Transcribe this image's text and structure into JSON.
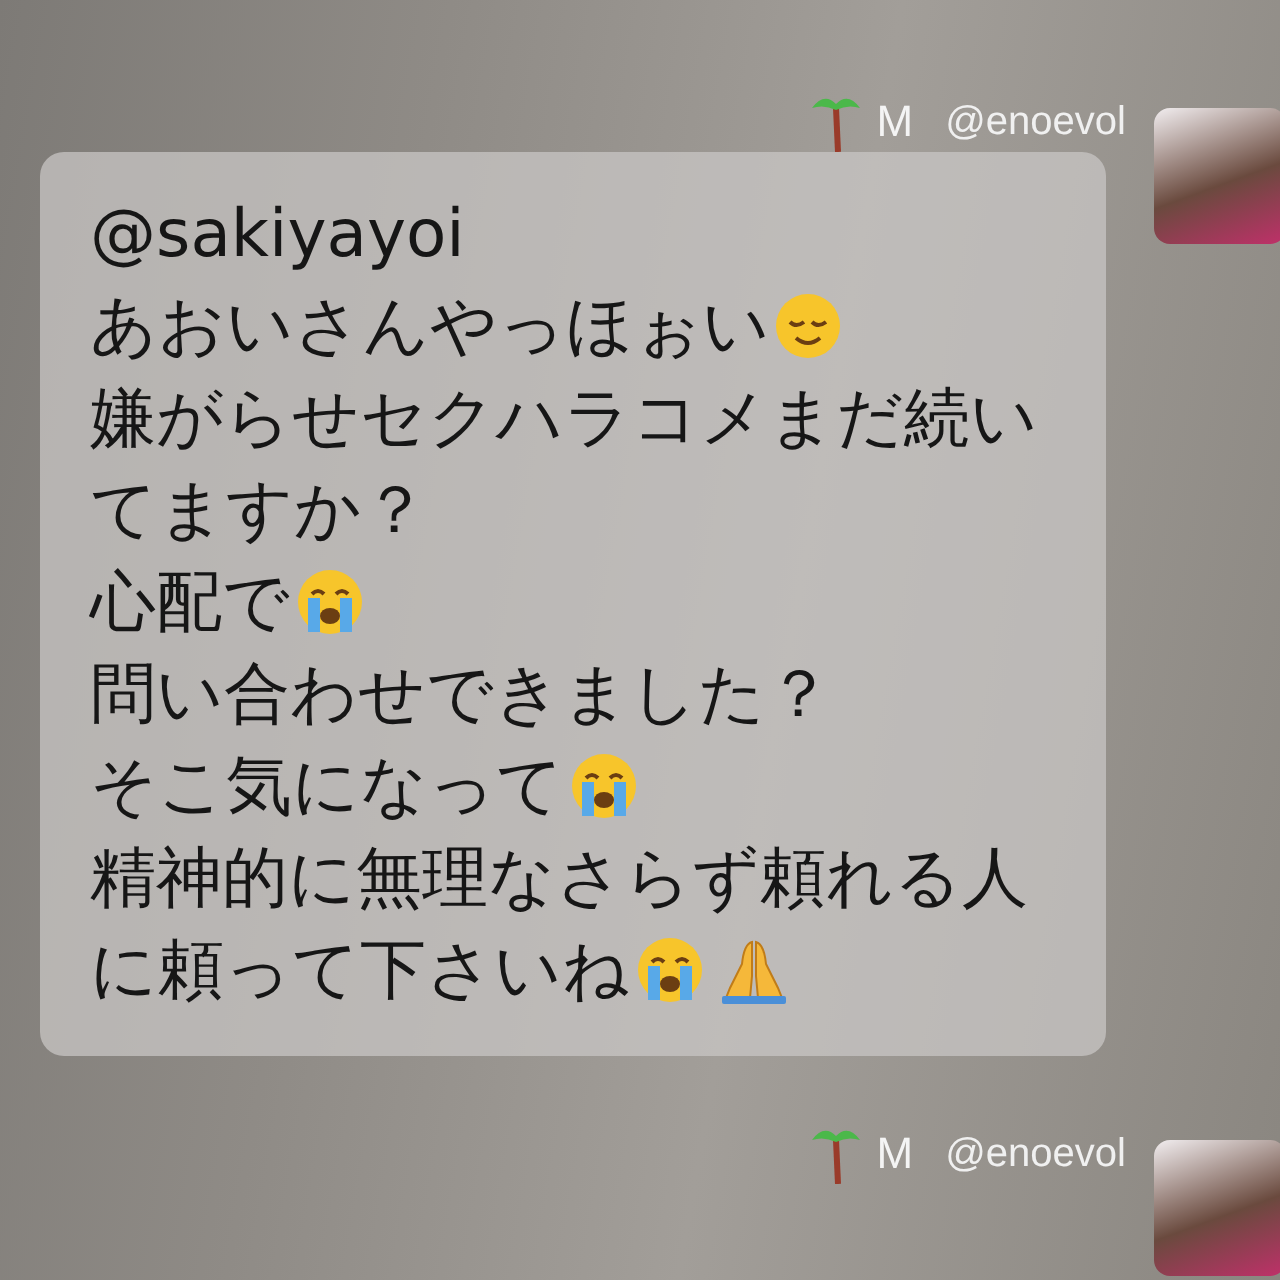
{
  "messages": [
    {
      "display_name": "M",
      "handle": "@enoevol",
      "lines": [
        {
          "text": "@sakiyayoi"
        },
        {
          "text": "あおいさんやっほぉい",
          "emojis": [
            {
              "kind": "relieved"
            }
          ]
        },
        {
          "text": "嫌がらせセクハラコメまだ続い"
        },
        {
          "text": "てますか？"
        },
        {
          "text": "心配で",
          "emojis": [
            {
              "kind": "crying"
            }
          ]
        },
        {
          "text": "問い合わせできました？"
        },
        {
          "text": "そこ気になって",
          "emojis": [
            {
              "kind": "crying"
            }
          ]
        },
        {
          "text": "精神的に無理なさらず頼れる人"
        },
        {
          "text": "に頼って下さいね",
          "emojis": [
            {
              "kind": "crying"
            },
            {
              "kind": "pray"
            }
          ]
        }
      ]
    },
    {
      "display_name": "M",
      "handle": "@enoevol"
    }
  ]
}
